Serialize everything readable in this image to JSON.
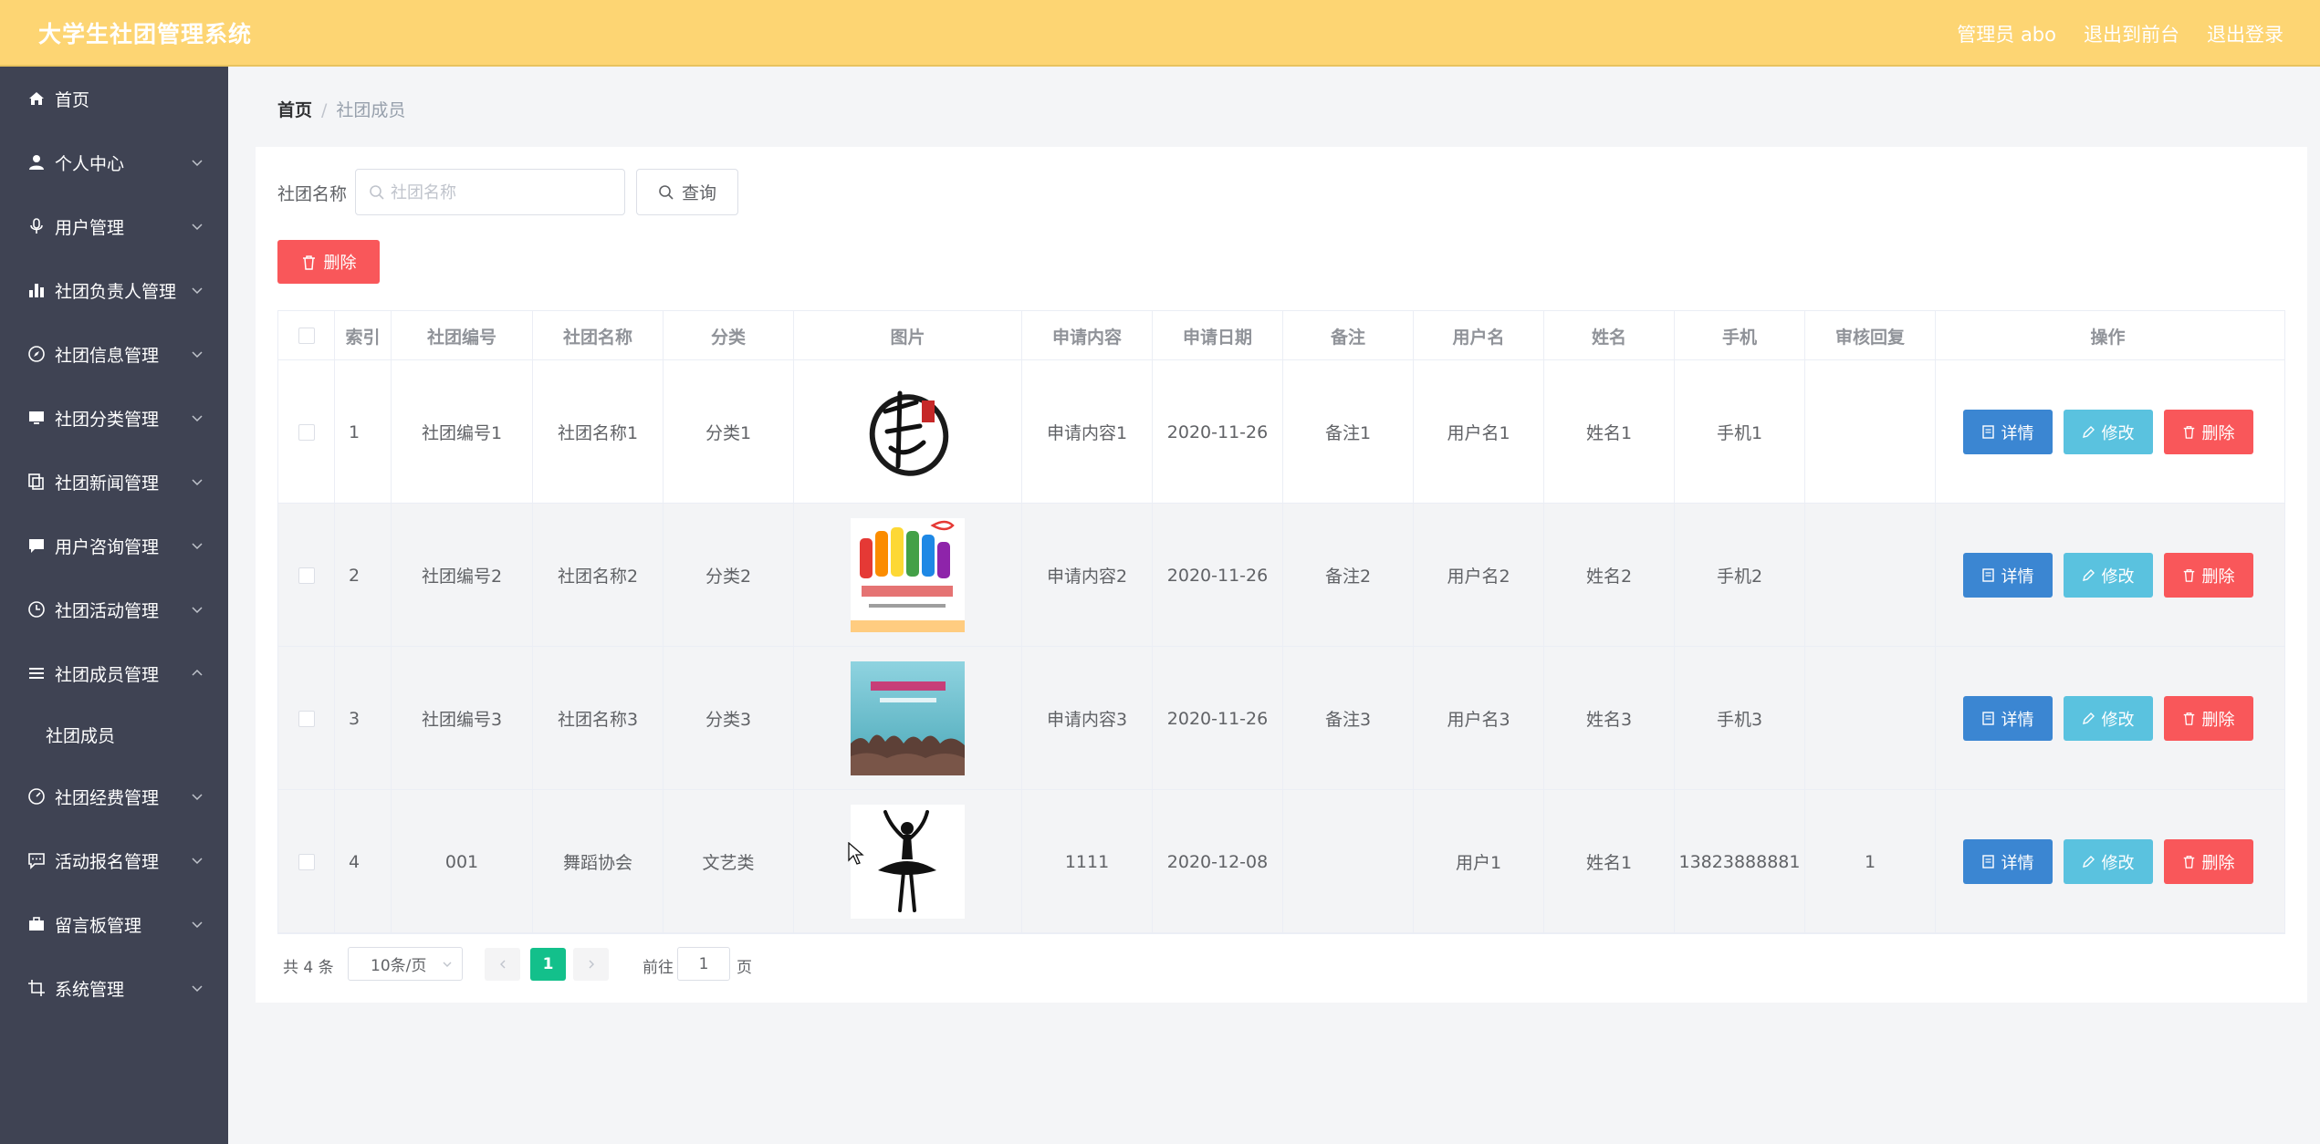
{
  "header": {
    "title": "大学生社团管理系统",
    "admin_label": "管理员 abo",
    "front_link": "退出到前台",
    "logout_link": "退出登录"
  },
  "sidebar": {
    "items": [
      {
        "label": "首页",
        "icon": "home-icon"
      },
      {
        "label": "个人中心",
        "icon": "user-icon"
      },
      {
        "label": "用户管理",
        "icon": "microphone-icon"
      },
      {
        "label": "社团负责人管理",
        "icon": "bar-chart-icon"
      },
      {
        "label": "社团信息管理",
        "icon": "compass-icon"
      },
      {
        "label": "社团分类管理",
        "icon": "monitor-icon"
      },
      {
        "label": "社团新闻管理",
        "icon": "copy-icon"
      },
      {
        "label": "用户咨询管理",
        "icon": "chat-icon"
      },
      {
        "label": "社团活动管理",
        "icon": "clock-icon"
      },
      {
        "label": "社团成员管理",
        "icon": "menu-icon"
      },
      {
        "label": "社团经费管理",
        "icon": "gauge-icon"
      },
      {
        "label": "活动报名管理",
        "icon": "comment-icon"
      },
      {
        "label": "留言板管理",
        "icon": "suitcase-icon"
      },
      {
        "label": "系统管理",
        "icon": "crop-icon"
      }
    ],
    "sub_item": "社团成员"
  },
  "breadcrumb": {
    "home": "首页",
    "current": "社团成员"
  },
  "search": {
    "label": "社团名称",
    "placeholder": "社团名称",
    "query_button": "查询",
    "delete_button": "删除"
  },
  "table": {
    "columns": [
      "索引",
      "社团编号",
      "社团名称",
      "分类",
      "图片",
      "申请内容",
      "申请日期",
      "备注",
      "用户名",
      "姓名",
      "手机",
      "审核回复",
      "操作"
    ],
    "rows": [
      {
        "index": "1",
        "code": "社团编号1",
        "name": "社团名称1",
        "category": "分类1",
        "image": "calligraphy-logo",
        "content": "申请内容1",
        "date": "2020-11-26",
        "note": "备注1",
        "username": "用户名1",
        "realname": "姓名1",
        "phone": "手机1",
        "reply": ""
      },
      {
        "index": "2",
        "code": "社团编号2",
        "name": "社团名称2",
        "category": "分类2",
        "image": "hands-poster",
        "content": "申请内容2",
        "date": "2020-11-26",
        "note": "备注2",
        "username": "用户名2",
        "realname": "姓名2",
        "phone": "手机2",
        "reply": ""
      },
      {
        "index": "3",
        "code": "社团编号3",
        "name": "社团名称3",
        "category": "分类3",
        "image": "club-poster",
        "content": "申请内容3",
        "date": "2020-11-26",
        "note": "备注3",
        "username": "用户名3",
        "realname": "姓名3",
        "phone": "手机3",
        "reply": ""
      },
      {
        "index": "4",
        "code": "001",
        "name": "舞蹈协会",
        "category": "文艺类",
        "image": "ballerina-silhouette",
        "content": "1111",
        "date": "2020-12-08",
        "note": "",
        "username": "用户1",
        "realname": "姓名1",
        "phone": "13823888881",
        "reply": "1"
      }
    ],
    "actions": {
      "detail": "详情",
      "edit": "修改",
      "remove": "删除"
    }
  },
  "pagination": {
    "total": "共 4 条",
    "page_size": "10条/页",
    "current_page": "1",
    "goto_label": "前往",
    "goto_value": "1",
    "page_suffix": "页"
  },
  "colors": {
    "header_bg": "#fdd573",
    "sidebar_bg": "#3f4353",
    "detail_btn": "#3b86d2",
    "edit_btn": "#5ac2df",
    "delete_btn": "#f9575a",
    "page_active": "#13c08b"
  }
}
